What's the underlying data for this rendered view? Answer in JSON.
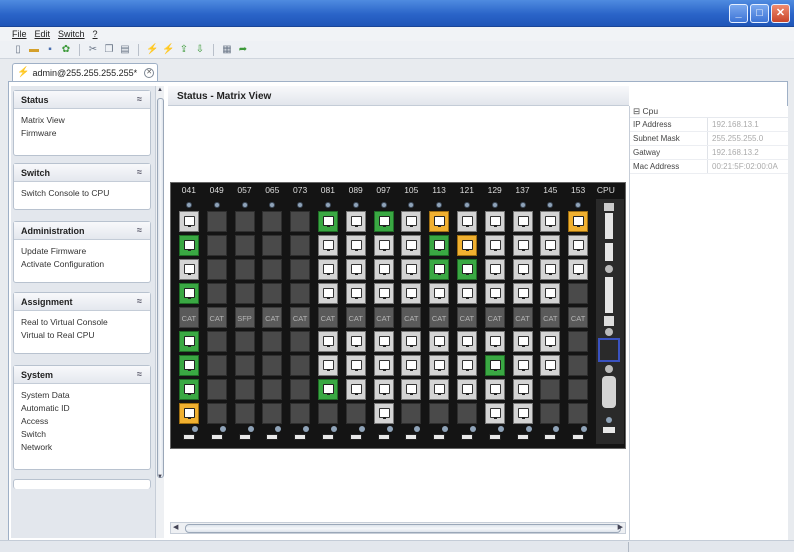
{
  "window": {
    "title": ""
  },
  "menu": [
    "File",
    "Edit",
    "Switch",
    "?"
  ],
  "toolbar_icons": [
    "new-icon",
    "open-icon",
    "save-icon",
    "refresh-icon",
    "cut-icon",
    "copy-icon",
    "paste-icon",
    "connect-icon",
    "disconnect-icon",
    "upload-icon",
    "download-icon",
    "document-icon",
    "export-icon"
  ],
  "tab": {
    "label": "admin@255.255.255.255*"
  },
  "sidebar": {
    "panels": [
      {
        "title": "Status",
        "items": [
          "Matrix View",
          "Firmware"
        ]
      },
      {
        "title": "Switch",
        "items": [
          "Switch Console to CPU"
        ]
      },
      {
        "title": "Administration",
        "items": [
          "Update Firmware",
          "Activate Configuration"
        ]
      },
      {
        "title": "Assignment",
        "items": [
          "Real to Virtual Console",
          "Virtual to Real CPU"
        ]
      },
      {
        "title": "System",
        "items": [
          "System Data",
          "Automatic ID",
          "Access",
          "Switch",
          "Network"
        ]
      }
    ]
  },
  "content": {
    "title": "Status - Matrix View"
  },
  "matrix": {
    "columns": [
      "041",
      "049",
      "057",
      "065",
      "073",
      "081",
      "089",
      "097",
      "105",
      "113",
      "121",
      "129",
      "137",
      "145",
      "153",
      "CPU"
    ],
    "cat_label": "CAT",
    "sfp_label": "SFP",
    "port_rows": [
      [
        "on",
        "off",
        "off",
        "off",
        "off",
        "green",
        "on",
        "green",
        "on",
        "yellow",
        "on",
        "on",
        "on",
        "on",
        "yellow"
      ],
      [
        "green",
        "off",
        "off",
        "off",
        "off",
        "on",
        "on",
        "on",
        "on",
        "green",
        "yellow",
        "on",
        "on",
        "on",
        "on"
      ],
      [
        "on",
        "off",
        "off",
        "off",
        "off",
        "on",
        "on",
        "on",
        "on",
        "green",
        "green",
        "on",
        "on",
        "on",
        "on"
      ],
      [
        "green",
        "off",
        "off",
        "off",
        "off",
        "on",
        "on",
        "on",
        "on",
        "on",
        "on",
        "on",
        "on",
        "on",
        "off"
      ],
      [
        "cat",
        "cat",
        "sfp",
        "cat",
        "cat",
        "cat",
        "cat",
        "cat",
        "cat",
        "cat",
        "cat",
        "cat",
        "cat",
        "cat",
        "cat"
      ],
      [
        "green",
        "off",
        "off",
        "off",
        "off",
        "on",
        "on",
        "on",
        "on",
        "on",
        "on",
        "on",
        "on",
        "on",
        "off"
      ],
      [
        "green",
        "off",
        "off",
        "off",
        "off",
        "on",
        "on",
        "on",
        "on",
        "on",
        "on",
        "green",
        "on",
        "on",
        "off"
      ],
      [
        "green",
        "off",
        "off",
        "off",
        "off",
        "green",
        "on",
        "on",
        "on",
        "on",
        "on",
        "on",
        "on",
        "off",
        "off"
      ],
      [
        "yellow",
        "off",
        "off",
        "off",
        "off",
        "off",
        "off",
        "on",
        "off",
        "off",
        "off",
        "on",
        "on",
        "off",
        "off"
      ]
    ]
  },
  "properties": {
    "group": "Cpu",
    "rows": [
      {
        "key": "IP Address",
        "value": "192.168.13.1"
      },
      {
        "key": "Subnet Mask",
        "value": "255.255.255.0"
      },
      {
        "key": "Gatway",
        "value": "192.168.13.2"
      },
      {
        "key": "Mac Address",
        "value": "00:21:5F:02:00:0A"
      }
    ]
  }
}
